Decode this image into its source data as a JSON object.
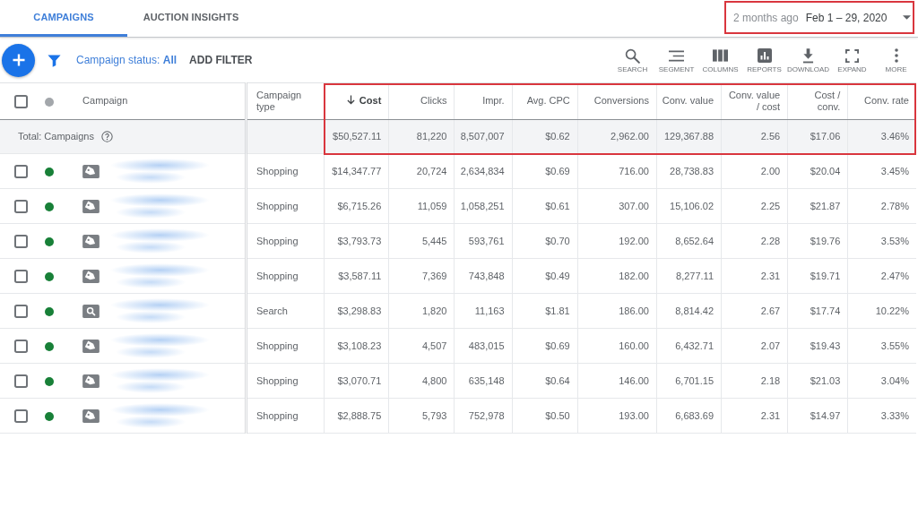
{
  "tabs": [
    {
      "label": "CAMPAIGNS",
      "selected": true
    },
    {
      "label": "AUCTION INSIGHTS",
      "selected": false
    }
  ],
  "date_range": {
    "relative": "2 months ago",
    "range": "Feb 1 – 29, 2020",
    "highlighted": true
  },
  "toolbar": {
    "status_filter": "Campaign status: **All**",
    "add_filter": "ADD FILTER",
    "tools": [
      {
        "kind": "search",
        "label": "SEARCH"
      },
      {
        "kind": "segment",
        "label": "SEGMENT"
      },
      {
        "kind": "columns",
        "label": "COLUMNS"
      },
      {
        "kind": "reports",
        "label": "REPORTS"
      },
      {
        "kind": "download",
        "label": "DOWNLOAD"
      },
      {
        "kind": "expand",
        "label": "EXPAND"
      },
      {
        "kind": "more",
        "label": "MORE"
      }
    ]
  },
  "table": {
    "select_all": {
      "checked": false
    },
    "metrics_highlighted": true,
    "columns": [
      {
        "kind": "name",
        "label": "Campaign",
        "sorted": false
      },
      {
        "kind": "text",
        "label": "Campaign type",
        "sorted": false
      },
      {
        "kind": "metric",
        "label": "Cost",
        "sorted": true
      },
      {
        "kind": "metric",
        "label": "Clicks",
        "sorted": false
      },
      {
        "kind": "metric",
        "label": "Impr.",
        "sorted": false
      },
      {
        "kind": "metric",
        "label": "Avg. CPC",
        "sorted": false
      },
      {
        "kind": "metric",
        "label": "Conversions",
        "sorted": false
      },
      {
        "kind": "metric",
        "label": "Conv. value",
        "sorted": false
      },
      {
        "kind": "metric",
        "label": "Conv. value / cost",
        "sorted": false
      },
      {
        "kind": "metric",
        "label": "Cost / conv.",
        "sorted": false
      },
      {
        "kind": "metric",
        "label": "Conv. rate",
        "sorted": false
      }
    ],
    "total": {
      "label": "Total: Campaigns",
      "values": [
        "$50,527.11",
        "81,220",
        "8,507,007",
        "$0.62",
        "2,962.00",
        "129,367.88",
        "2.56",
        "$17.06",
        "3.46%"
      ]
    },
    "rows": [
      {
        "checked": false,
        "color": "#188038",
        "kind": "shopping",
        "type": "Shopping",
        "values": [
          "$14,347.77",
          "20,724",
          "2,634,834",
          "$0.69",
          "716.00",
          "28,738.83",
          "2.00",
          "$20.04",
          "3.45%"
        ]
      },
      {
        "checked": false,
        "color": "#188038",
        "kind": "shopping",
        "type": "Shopping",
        "values": [
          "$6,715.26",
          "11,059",
          "1,058,251",
          "$0.61",
          "307.00",
          "15,106.02",
          "2.25",
          "$21.87",
          "2.78%"
        ]
      },
      {
        "checked": false,
        "color": "#188038",
        "kind": "shopping",
        "type": "Shopping",
        "values": [
          "$3,793.73",
          "5,445",
          "593,761",
          "$0.70",
          "192.00",
          "8,652.64",
          "2.28",
          "$19.76",
          "3.53%"
        ]
      },
      {
        "checked": false,
        "color": "#188038",
        "kind": "shopping",
        "type": "Shopping",
        "values": [
          "$3,587.11",
          "7,369",
          "743,848",
          "$0.49",
          "182.00",
          "8,277.11",
          "2.31",
          "$19.71",
          "2.47%"
        ]
      },
      {
        "checked": false,
        "color": "#188038",
        "kind": "search",
        "type": "Search",
        "values": [
          "$3,298.83",
          "1,820",
          "11,163",
          "$1.81",
          "186.00",
          "8,814.42",
          "2.67",
          "$17.74",
          "10.22%"
        ]
      },
      {
        "checked": false,
        "color": "#188038",
        "kind": "shopping",
        "type": "Shopping",
        "values": [
          "$3,108.23",
          "4,507",
          "483,015",
          "$0.69",
          "160.00",
          "6,432.71",
          "2.07",
          "$19.43",
          "3.55%"
        ]
      },
      {
        "checked": false,
        "color": "#188038",
        "kind": "shopping",
        "type": "Shopping",
        "values": [
          "$3,070.71",
          "4,800",
          "635,148",
          "$0.64",
          "146.00",
          "6,701.15",
          "2.18",
          "$21.03",
          "3.04%"
        ]
      },
      {
        "checked": false,
        "color": "#188038",
        "kind": "shopping",
        "type": "Shopping",
        "values": [
          "$2,888.75",
          "5,793",
          "752,978",
          "$0.50",
          "193.00",
          "6,683.69",
          "2.31",
          "$14.97",
          "3.33%"
        ]
      }
    ]
  }
}
